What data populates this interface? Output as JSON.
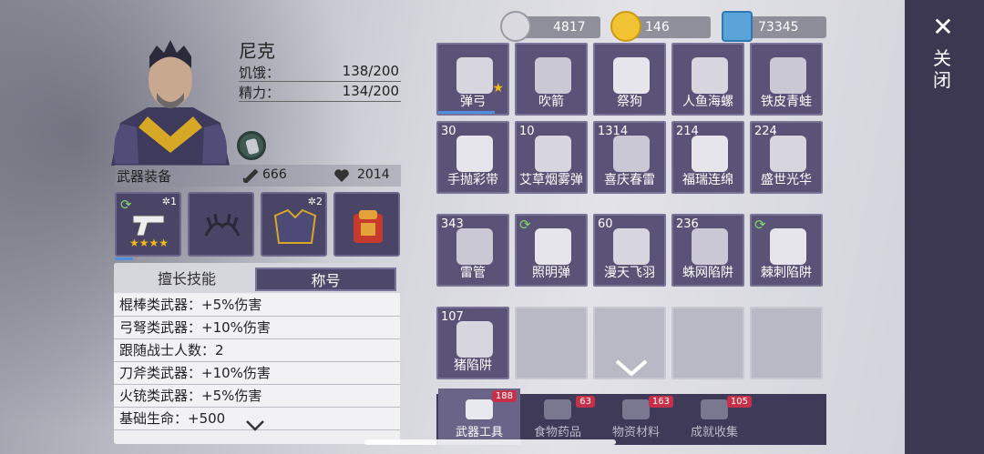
{
  "character": {
    "name": "尼克",
    "stats": [
      {
        "label": "饥饿：",
        "value": "138/200"
      },
      {
        "label": "精力：",
        "value": "134/200"
      }
    ],
    "weapon_section_title": "武器装备",
    "attack": "666",
    "health": "2014"
  },
  "equipment": [
    {
      "icon": "pistol-icon",
      "badge": "✲1",
      "stars": "★★★★",
      "refresh": true
    },
    {
      "icon": "antler-icon",
      "badge": "",
      "stars": "",
      "refresh": false
    },
    {
      "icon": "armor-icon",
      "badge": "✲2",
      "stars": "",
      "refresh": false
    },
    {
      "icon": "backpack-icon",
      "badge": "",
      "stars": "",
      "refresh": false
    }
  ],
  "skills": {
    "tabs": [
      "擅长技能",
      "称号"
    ],
    "active_tab": "称号",
    "rows": [
      "棍棒类武器：+5%伤害",
      "弓弩类武器：+10%伤害",
      "跟随战士人数：2",
      "刀斧类武器：+10%伤害",
      "火铳类武器：+5%伤害",
      "基础生命：+500"
    ]
  },
  "currency": [
    {
      "icon": "silver-coins-icon",
      "value": "4817"
    },
    {
      "icon": "smiley-coin-icon",
      "value": "146"
    },
    {
      "icon": "photo-card-icon",
      "value": "73345"
    }
  ],
  "inventory": [
    {
      "name": "弹弓",
      "count": "",
      "icon": "slingshot-icon",
      "star": true
    },
    {
      "name": "吹箭",
      "count": "",
      "icon": "blowpipe-icon"
    },
    {
      "name": "祭狗",
      "count": "",
      "icon": "dog-charm-icon"
    },
    {
      "name": "人鱼海螺",
      "count": "",
      "icon": "conch-icon"
    },
    {
      "name": "铁皮青蛙",
      "count": "",
      "icon": "tin-frog-icon"
    },
    {
      "name": "手抛彩带",
      "count": "30",
      "icon": "party-popper-icon"
    },
    {
      "name": "艾草烟雾弹",
      "count": "10",
      "icon": "smoke-bomb-icon"
    },
    {
      "name": "喜庆春雷",
      "count": "1314",
      "icon": "firecracker-icon"
    },
    {
      "name": "福瑞连绵",
      "count": "214",
      "icon": "firecracker-string-icon"
    },
    {
      "name": "盛世光华",
      "count": "224",
      "icon": "rocket-icon"
    },
    {
      "name": "雷管",
      "count": "343",
      "icon": "dynamite-icon"
    },
    {
      "name": "照明弹",
      "count": "",
      "icon": "flare-icon",
      "refresh": true
    },
    {
      "name": "漫天飞羽",
      "count": "60",
      "icon": "feather-darts-icon"
    },
    {
      "name": "蛛网陷阱",
      "count": "236",
      "icon": "web-trap-icon"
    },
    {
      "name": "棘刺陷阱",
      "count": "",
      "icon": "spike-trap-icon",
      "refresh": true
    },
    {
      "name": "猪陷阱",
      "count": "107",
      "icon": "pig-trap-icon"
    }
  ],
  "categories": [
    {
      "label": "武器工具",
      "badge": "188",
      "icon": "tools-icon",
      "active": true
    },
    {
      "label": "食物药品",
      "badge": "63",
      "icon": "food-icon"
    },
    {
      "label": "物资材料",
      "badge": "163",
      "icon": "materials-icon"
    },
    {
      "label": "成就收集",
      "badge": "105",
      "icon": "trophy-icon"
    }
  ],
  "close_label": "关闭"
}
